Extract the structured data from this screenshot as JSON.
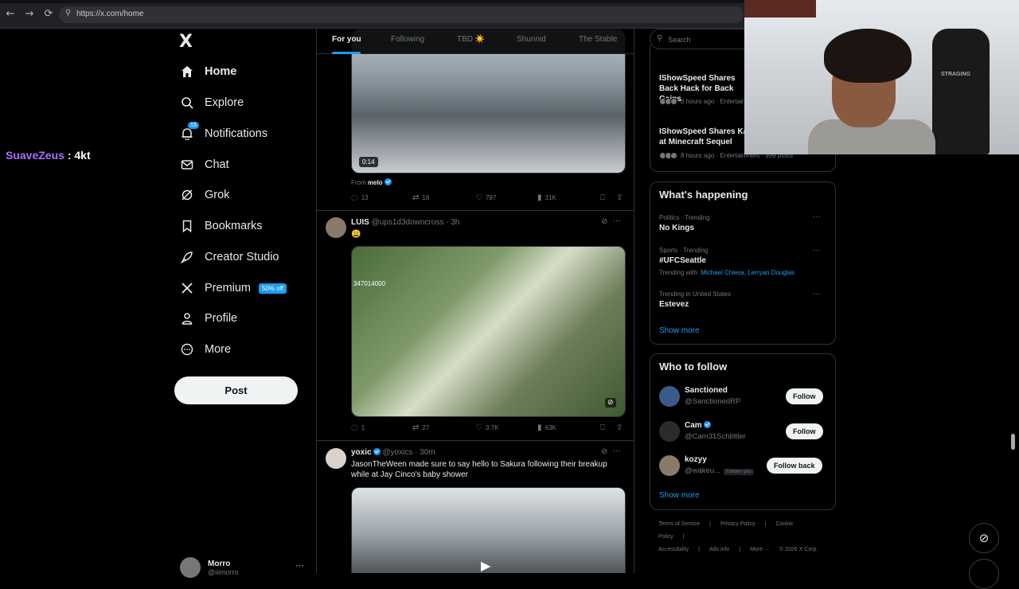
{
  "browser": {
    "url": "https://x.com/home",
    "back_icon": "←",
    "forward_icon": "→",
    "reload_icon": "⟳"
  },
  "chat_overlay": {
    "user": "SuaveZeus",
    "sep": " : ",
    "message": "4kt"
  },
  "nav": {
    "logo": "X",
    "items": [
      {
        "label": "Home",
        "icon": "home-icon"
      },
      {
        "label": "Explore",
        "icon": "search-icon"
      },
      {
        "label": "Notifications",
        "icon": "bell-icon",
        "badge": "15"
      },
      {
        "label": "Chat",
        "icon": "mail-icon"
      },
      {
        "label": "Grok",
        "icon": "grok-icon"
      },
      {
        "label": "Bookmarks",
        "icon": "bookmark-icon"
      },
      {
        "label": "Creator Studio",
        "icon": "rocket-icon"
      },
      {
        "label": "Premium",
        "icon": "x-icon",
        "badge": "50% off"
      },
      {
        "label": "Profile",
        "icon": "person-icon"
      },
      {
        "label": "More",
        "icon": "more-circle-icon"
      }
    ],
    "post_button": "Post",
    "account": {
      "name": "Morro",
      "handle": "@iiimorro",
      "more": "···"
    }
  },
  "feed": {
    "tabs": [
      "For you",
      "Following",
      "TBD ☀️",
      "Shunnid",
      "The Stable"
    ],
    "tweet1": {
      "duration": "0:14",
      "from_prefix": "From ",
      "from_user": "melo",
      "replies": "13",
      "retweets": "18",
      "likes": "797",
      "views": "31K"
    },
    "tweet2": {
      "name": "LUIS",
      "handle": "@ups1d3downcross",
      "time": "· 3h",
      "text": "😩",
      "overlay_text": "347014000",
      "replies": "1",
      "retweets": "27",
      "likes": "3.7K",
      "views": "63K"
    },
    "tweet3": {
      "name": "yoxic",
      "handle": "@yoxics",
      "time": "· 30m",
      "text": "JasonTheWeen made sure to say hello to Sakura following their breakup while at Jay Cinco's baby shower"
    }
  },
  "right": {
    "search_placeholder": "Search",
    "news": [
      {
        "title": "IShowSpeed Shares Back Hack for Back Gains",
        "meta": "6 hours ago · Entertainment"
      },
      {
        "title": "IShowSpeed Shares Ka at Minecraft Sequel",
        "meta": "8 hours ago · Entertainment · 999 posts"
      }
    ],
    "whats_happening": {
      "title": "What's happening",
      "trends": [
        {
          "context": "Politics · Trending",
          "name": "No Kings"
        },
        {
          "context": "Sports · Trending",
          "name": "#UFCSeattle",
          "with_prefix": "Trending with",
          "with_links": "Michael Chiesa, Lerryan Douglas"
        },
        {
          "context": "Trending in United States",
          "name": "Estevez"
        }
      ],
      "show_more": "Show more"
    },
    "who_to_follow": {
      "title": "Who to follow",
      "accounts": [
        {
          "name": "Sanctioned",
          "handle": "@SanctionedRP",
          "button": "Follow"
        },
        {
          "name": "Cam",
          "handle": "@Cam31Schlittler",
          "button": "Follow"
        },
        {
          "name": "kozyy",
          "handle": "@wakeu...",
          "follows_you": "Follows you",
          "button": "Follow back"
        }
      ],
      "show_more": "Show more"
    },
    "footer": [
      "Terms of Service",
      "|",
      "Privacy Policy",
      "|",
      "Cookie Policy",
      "|",
      "Accessibility",
      "|",
      "Ads info",
      "|",
      "More ···",
      "© 2026 X Corp."
    ]
  },
  "webcam": {
    "chair_brand": "STRAGING"
  }
}
